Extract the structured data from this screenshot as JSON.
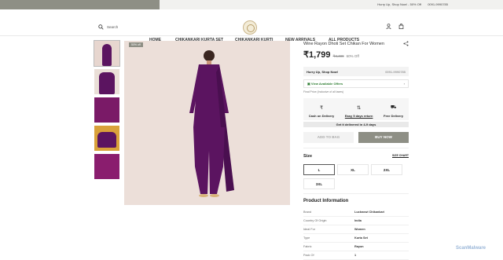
{
  "topbar": {
    "message": "Hurry Up, Shop Now! - 50% Off",
    "phone": "0091-9990785"
  },
  "header": {
    "search_placeholder": "Search"
  },
  "nav": [
    "HOME",
    "CHIKANKARI KURTA SET",
    "CHIKANKARI KURTI",
    "NEW ARRIVALS",
    "ALL PRODUCTS"
  ],
  "gallery": {
    "badge": "50% off"
  },
  "product": {
    "title": "Wine Rayon Dhoti Set Chikan For Women",
    "price": "₹1,799",
    "mrp": "₹4,499",
    "discount": "60% Off",
    "hurry": "Hurry Up, Shop Now!",
    "phone": "0091-9990785",
    "offers": "View Available Offers",
    "inclusive": "Final Price (Inclusive of all taxes)",
    "features": [
      "Cash on Delivery",
      "Easy 5 days return",
      "Free Delivery"
    ],
    "delivery": "Get it delivered in 4-9 days",
    "add_to_bag": "ADD TO BAG",
    "buy_now": "BUY NOW",
    "size_label": "Size",
    "size_chart": "SIZE CHART",
    "sizes": [
      "L",
      "XL",
      "2XL",
      "3XL"
    ]
  },
  "info": {
    "heading": "Product Information",
    "rows": [
      {
        "k": "Brand",
        "v": "Lucknowi Chikankari"
      },
      {
        "k": "Country Of Origin",
        "v": "India"
      },
      {
        "k": "Ideal For",
        "v": "Women"
      },
      {
        "k": "Type",
        "v": "Kurta Set"
      },
      {
        "k": "Fabric",
        "v": "Rayon"
      },
      {
        "k": "Pack Of",
        "v": "1"
      }
    ]
  },
  "watermark": "ScanMalware",
  "colors": {
    "accent": "#8e8f85",
    "product": "#5b1460"
  }
}
